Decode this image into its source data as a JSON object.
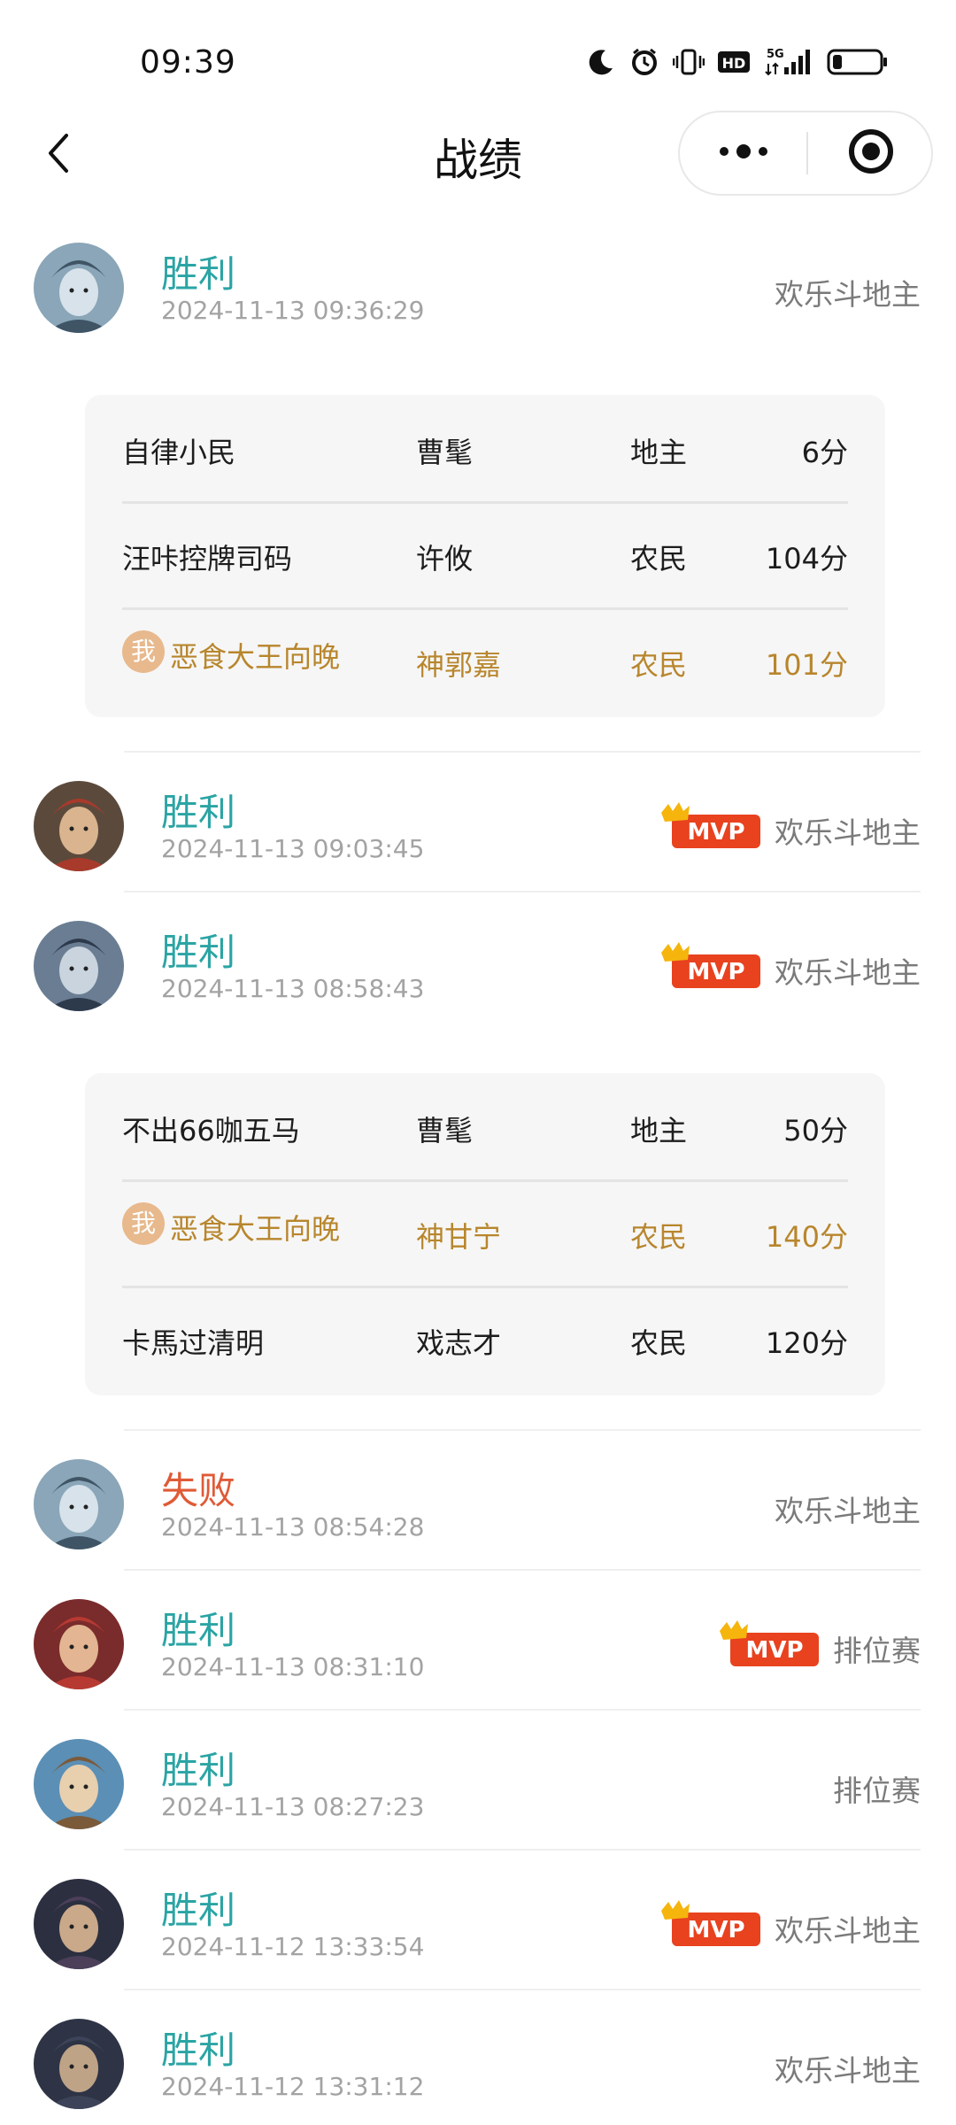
{
  "status_bar": {
    "time": "09:39",
    "icons": [
      "moon-icon",
      "alarm-icon",
      "vibrate-icon",
      "hd-icon",
      "signal-5g-icon",
      "battery-icon"
    ],
    "hd_label": "HD",
    "network_label": "5G",
    "battery_level": 0.2
  },
  "nav": {
    "title": "战绩",
    "back_icon": "chevron-left-icon",
    "more_icon": "more-dots-icon",
    "close_icon": "target-circle-icon"
  },
  "colors": {
    "win": "#2ba4a4",
    "lose": "#e05a36",
    "me": "#b8862d",
    "mvp_red": "#e8421f",
    "crown": "#f5b50d"
  },
  "records": [
    {
      "result": "胜利",
      "time": "2024-11-13 09:36:29",
      "mode": "欢乐斗地主",
      "mvp": false,
      "expanded": true,
      "players": [
        {
          "name": "自律小民",
          "character": "曹髦",
          "role": "地主",
          "score": "6分",
          "is_me": false
        },
        {
          "name": "汪咔控牌司码",
          "character": "许攸",
          "role": "农民",
          "score": "104分",
          "is_me": false
        },
        {
          "name": "恶食大王向晚",
          "character": "神郭嘉",
          "role": "农民",
          "score": "101分",
          "is_me": true
        }
      ]
    },
    {
      "result": "胜利",
      "time": "2024-11-13 09:03:45",
      "mode": "欢乐斗地主",
      "mvp": true
    },
    {
      "result": "胜利",
      "time": "2024-11-13 08:58:43",
      "mode": "欢乐斗地主",
      "mvp": true,
      "expanded": true,
      "players": [
        {
          "name": "不出66咖五马",
          "character": "曹髦",
          "role": "地主",
          "score": "50分",
          "is_me": false
        },
        {
          "name": "恶食大王向晚",
          "character": "神甘宁",
          "role": "农民",
          "score": "140分",
          "is_me": true
        },
        {
          "name": "卡馬过清明",
          "character": "戏志才",
          "role": "农民",
          "score": "120分",
          "is_me": false
        }
      ]
    },
    {
      "result": "失败",
      "time": "2024-11-13 08:54:28",
      "mode": "欢乐斗地主",
      "mvp": false
    },
    {
      "result": "胜利",
      "time": "2024-11-13 08:31:10",
      "mode": "排位赛",
      "mvp": true
    },
    {
      "result": "胜利",
      "time": "2024-11-13 08:27:23",
      "mode": "排位赛",
      "mvp": false
    },
    {
      "result": "胜利",
      "time": "2024-11-12 13:33:54",
      "mode": "欢乐斗地主",
      "mvp": true
    },
    {
      "result": "胜利",
      "time": "2024-11-12 13:31:12",
      "mode": "欢乐斗地主",
      "mvp": false
    }
  ],
  "labels": {
    "mvp": "MVP",
    "me_badge": "我"
  }
}
